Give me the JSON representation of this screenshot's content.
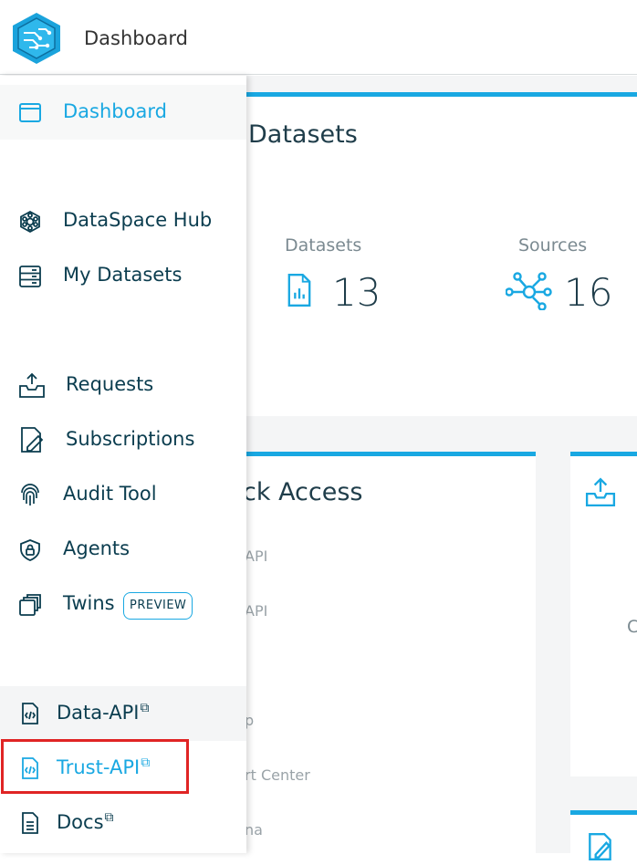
{
  "header": {
    "title": "Dashboard"
  },
  "datasets_card": {
    "title": "Datasets",
    "stats": [
      {
        "label": "Datasets",
        "value": "13",
        "icon": "report-file-icon"
      },
      {
        "label": "Sources",
        "value": "16",
        "icon": "network-nodes-icon"
      }
    ]
  },
  "quick_access": {
    "title": "ck Access",
    "items": [
      "API",
      "API",
      "p",
      "rt Center",
      "na"
    ]
  },
  "requests_card": {
    "partial_text": "C"
  },
  "sidebar": {
    "items": [
      {
        "label": "Dashboard",
        "icon": "window-icon"
      },
      {
        "label": "DataSpace Hub",
        "icon": "hub-icon"
      },
      {
        "label": "My Datasets",
        "icon": "server-icon"
      },
      {
        "label": "Requests",
        "icon": "inbox-upload-icon"
      },
      {
        "label": "Subscriptions",
        "icon": "document-edit-icon"
      },
      {
        "label": "Audit Tool",
        "icon": "fingerprint-icon"
      },
      {
        "label": "Agents",
        "icon": "shield-lock-icon"
      },
      {
        "label": "Twins",
        "icon": "copy-icon",
        "badge": "PREVIEW"
      },
      {
        "label": "Data-API",
        "icon": "code-file-icon",
        "external": "⧉"
      },
      {
        "label": "Trust-API",
        "icon": "code-file-icon",
        "external": "⧉"
      },
      {
        "label": "Docs",
        "icon": "text-file-icon",
        "external": "⧉"
      }
    ]
  },
  "colors": {
    "accent": "#19a8e2",
    "nav_text": "#0b3d4f",
    "highlight": "#e02424"
  }
}
